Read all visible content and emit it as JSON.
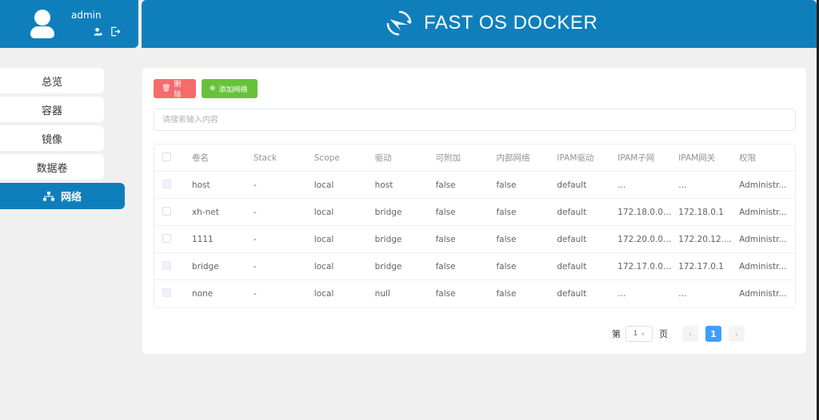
{
  "user": {
    "name": "admin"
  },
  "brand": {
    "title": "FAST OS DOCKER"
  },
  "sidebar": {
    "items": [
      {
        "label": "总览"
      },
      {
        "label": "容器"
      },
      {
        "label": "镜像"
      },
      {
        "label": "数据卷"
      },
      {
        "label": "网络",
        "active": true
      }
    ]
  },
  "toolbar": {
    "delete_label": "删除",
    "add_label": "添加网络"
  },
  "search": {
    "placeholder": "请搜索输入内容"
  },
  "table": {
    "headers": [
      "卷名",
      "Stack",
      "Scope",
      "驱动",
      "可附加",
      "内部网络",
      "IPAM驱动",
      "IPAM子网",
      "IPAM网关",
      "权限"
    ],
    "rows": [
      {
        "disabled": true,
        "cells": [
          "host",
          "-",
          "local",
          "host",
          "false",
          "false",
          "default",
          "...",
          "...",
          "Administr..."
        ]
      },
      {
        "disabled": false,
        "cells": [
          "xh-net",
          "-",
          "local",
          "bridge",
          "false",
          "false",
          "default",
          "172.18.0.0...",
          "172.18.0.1",
          "Administr..."
        ]
      },
      {
        "disabled": false,
        "cells": [
          "1111",
          "-",
          "local",
          "bridge",
          "false",
          "false",
          "default",
          "172.20.0.0...",
          "172.20.12....",
          "Administr..."
        ]
      },
      {
        "disabled": true,
        "cells": [
          "bridge",
          "-",
          "local",
          "bridge",
          "false",
          "false",
          "default",
          "172.17.0.0...",
          "172.17.0.1",
          "Administr..."
        ]
      },
      {
        "disabled": true,
        "cells": [
          "none",
          "-",
          "local",
          "null",
          "false",
          "false",
          "default",
          "...",
          "...",
          "Administr..."
        ]
      }
    ]
  },
  "pagination": {
    "prefix": "第",
    "selected": "1",
    "suffix": "页",
    "current": "1",
    "prev": "‹",
    "next": "›"
  },
  "colors": {
    "primary": "#0f7fbc",
    "danger": "#f56c6c",
    "success": "#67c23a",
    "page_active": "#409eff"
  }
}
